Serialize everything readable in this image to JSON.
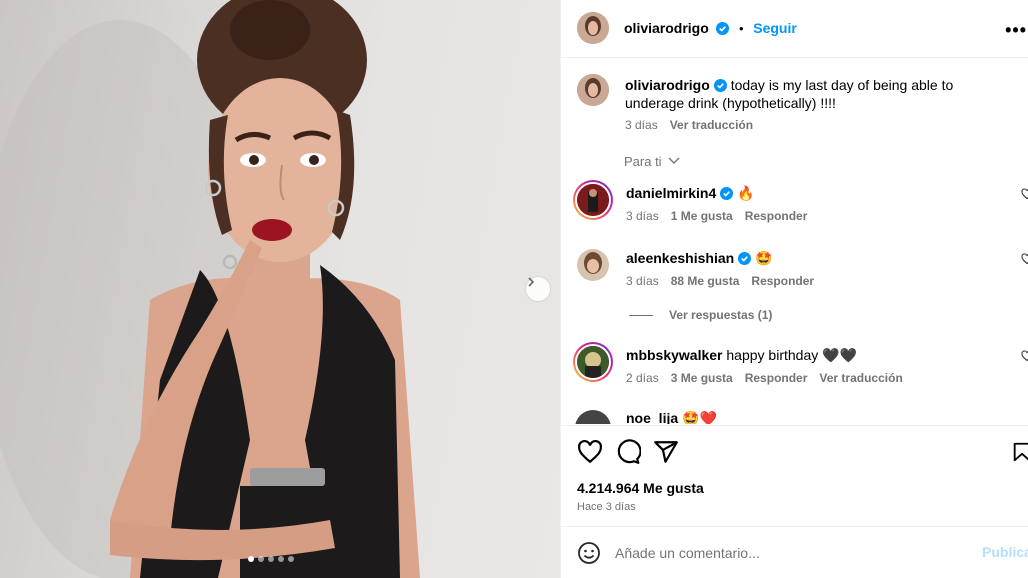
{
  "post": {
    "author": "oliviarodrigo",
    "follow_label": "Seguir",
    "more_label": "•••",
    "separator": "•",
    "caption": "today is my last day of being able to underage drink (hypothetically) !!!!",
    "caption_time": "3 días",
    "caption_translate": "Ver traducción",
    "carousel": {
      "slide_count": 5,
      "active_index": 0
    }
  },
  "comments_filter": "Para ti",
  "comments": [
    {
      "user": "danielmirkin4",
      "verified": true,
      "text": "🔥",
      "time": "3 días",
      "likes": "1 Me gusta",
      "reply": "Responder",
      "translate": ""
    },
    {
      "user": "aleenkeshishian",
      "verified": true,
      "text": "🤩",
      "time": "3 días",
      "likes": "88 Me gusta",
      "reply": "Responder",
      "translate": ""
    },
    {
      "user": "mbbskywalker",
      "verified": false,
      "text": "happy birthday 🖤🖤",
      "time": "2 días",
      "likes": "3 Me gusta",
      "reply": "Responder",
      "translate": "Ver traducción"
    },
    {
      "user": "noe_lija",
      "verified": false,
      "text": "🤩❤️",
      "time": "",
      "likes": "",
      "reply": "",
      "translate": ""
    }
  ],
  "view_replies": "Ver respuestas (1)",
  "likes_total": "4.214.964 Me gusta",
  "posted_ago": "Hace 3 días",
  "comment_box": {
    "placeholder": "Añade un comentario...",
    "post_label": "Publicar"
  },
  "colors": {
    "accent": "#0095f6",
    "muted": "#737373",
    "post_disabled": "#b2dffc",
    "verified": "#0095f6"
  },
  "icons": [
    "more-icon",
    "verified-icon",
    "chevron-down-icon",
    "heart-icon",
    "comment-icon",
    "share-icon",
    "save-icon",
    "emoji-icon",
    "chevron-right-icon"
  ]
}
